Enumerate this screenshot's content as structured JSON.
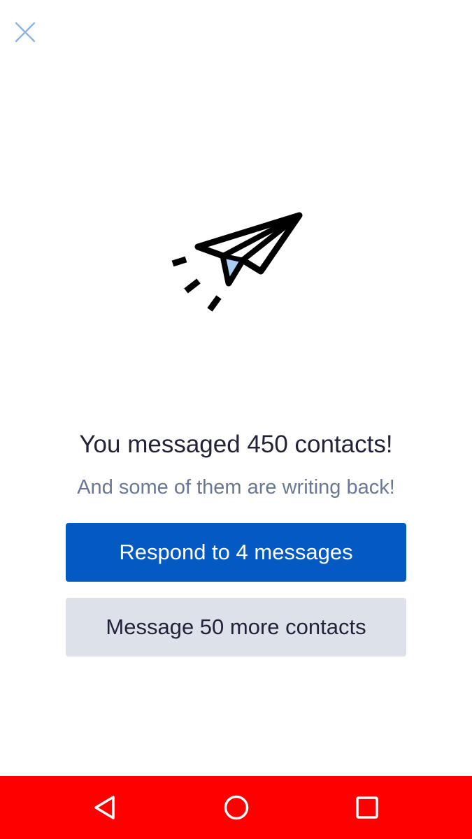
{
  "header": {
    "close_icon": "close-icon"
  },
  "illustration": {
    "icon": "paper-plane-icon",
    "accent_color": "#a9cdf5"
  },
  "main": {
    "headline": "You messaged 450 contacts!",
    "subhead": "And some of them are writing back!"
  },
  "actions": {
    "primary_label": "Respond to 4 messages",
    "secondary_label": "Message 50 more contacts"
  },
  "navbar": {
    "back_icon": "back-triangle-icon",
    "home_icon": "home-circle-icon",
    "recent_icon": "recent-apps-square-icon"
  },
  "colors": {
    "primary": "#0559c2",
    "secondary": "#dde1ea",
    "navbar": "#ff0000",
    "close_icon": "#8ab4ea"
  }
}
